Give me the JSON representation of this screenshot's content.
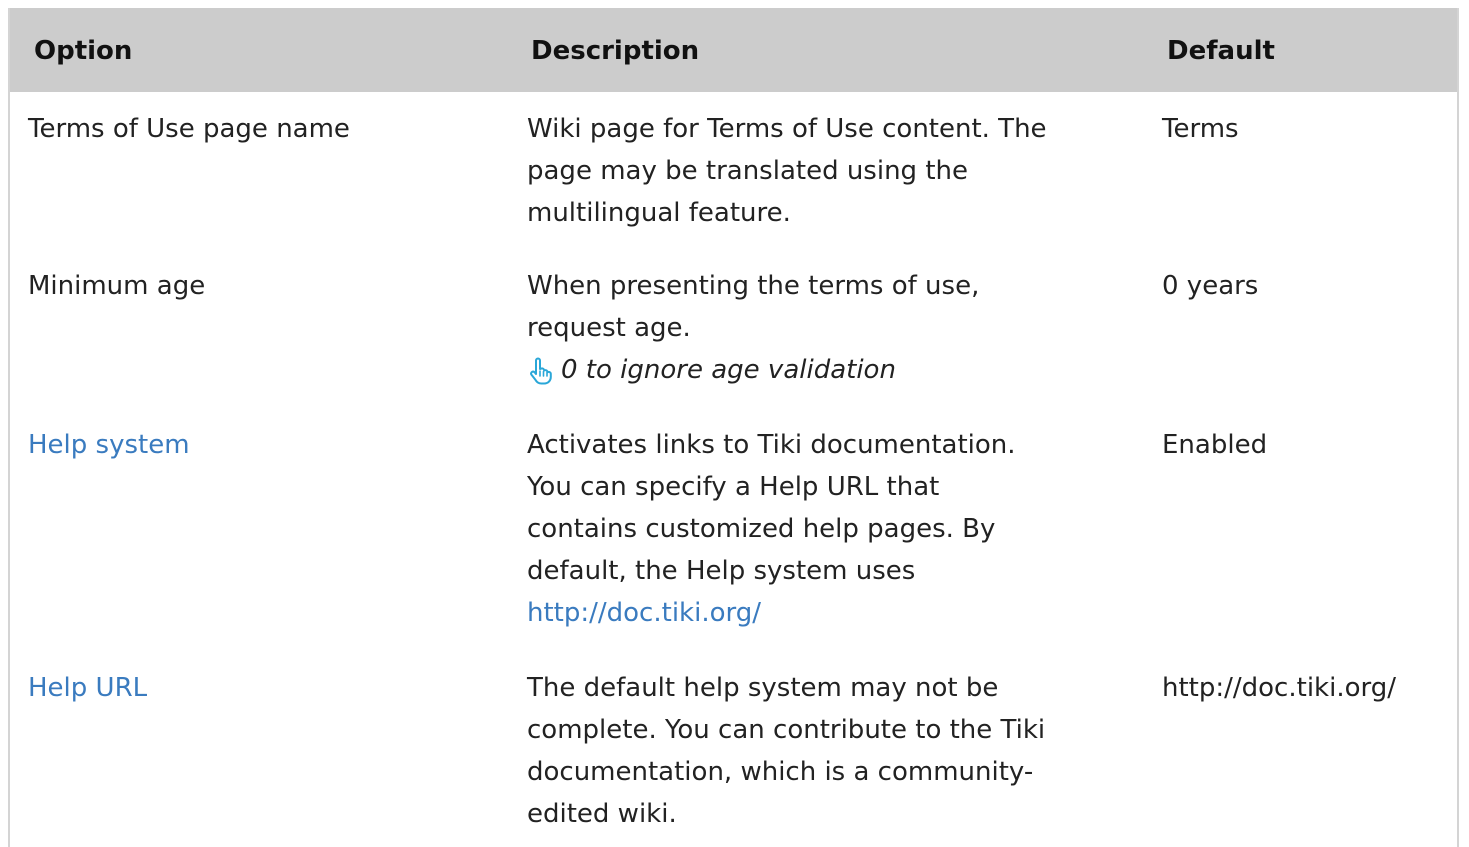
{
  "table": {
    "headers": {
      "option": "Option",
      "description": "Description",
      "default": "Default"
    },
    "rows": [
      {
        "option": "Terms of Use page name",
        "description_lines": [
          "Wiki page for Terms of Use content. The",
          "page may be translated using the",
          "multilingual feature."
        ],
        "default": "Terms"
      },
      {
        "option": "Minimum age",
        "description_lines": [
          "When presenting the terms of use,",
          "request age."
        ],
        "tip": "0 to ignore age validation",
        "tip_icon": "pointing-hand-icon",
        "default": "0 years"
      },
      {
        "option": "Help system",
        "option_is_link": true,
        "description_lines": [
          "Activates links to Tiki documentation.",
          "You can specify a Help URL that",
          "contains customized help pages. By",
          "default, the Help system uses"
        ],
        "description_link": "http://doc.tiki.org/",
        "default": "Enabled"
      },
      {
        "option": "Help URL",
        "option_is_link": true,
        "description_lines": [
          "The default help system may not be",
          "complete. You can contribute to the Tiki",
          "documentation, which is a community-",
          "edited wiki."
        ],
        "default": "http://doc.tiki.org/"
      }
    ]
  },
  "colors": {
    "header_bg": "#cccccc",
    "link": "#3a7bbf",
    "tip_icon": "#2aa7d8"
  }
}
